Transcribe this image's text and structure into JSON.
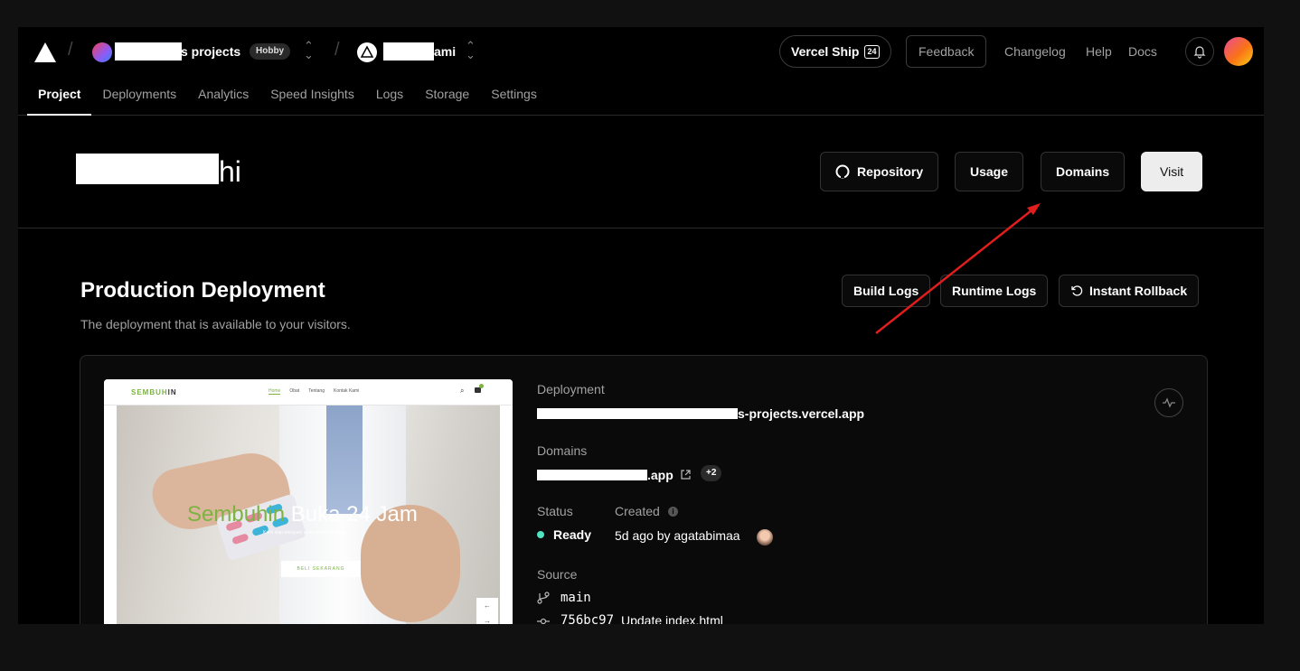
{
  "topbar": {
    "team_name_suffix": "s projects",
    "plan_badge": "Hobby",
    "project_name_suffix": "ami",
    "ship_label": "Vercel Ship",
    "ship_badge": "24",
    "feedback_label": "Feedback",
    "changelog_label": "Changelog",
    "help_label": "Help",
    "docs_label": "Docs"
  },
  "tabs": [
    "Project",
    "Deployments",
    "Analytics",
    "Speed Insights",
    "Logs",
    "Storage",
    "Settings"
  ],
  "header": {
    "project_title_suffix": "hi",
    "repository_label": "Repository",
    "usage_label": "Usage",
    "domains_label": "Domains",
    "visit_label": "Visit"
  },
  "production": {
    "title": "Production Deployment",
    "subtitle": "The deployment that is available to your visitors.",
    "build_logs_label": "Build Logs",
    "runtime_logs_label": "Runtime Logs",
    "rollback_label": "Instant Rollback"
  },
  "preview": {
    "brand_green": "SEMBUH",
    "brand_dark": "IN",
    "menu": [
      "Home",
      "Obat",
      "Tentang",
      "Kontak Kami"
    ],
    "headline_green": "Sembuhin",
    "headline_white": "Buka 24 Jam",
    "tagline": "Kami siap melayani anda selama 24 Jam",
    "cta": "BELI SEKARANG"
  },
  "deployment": {
    "deployment_label": "Deployment",
    "deployment_url_suffix": "s-projects.vercel.app",
    "domains_label": "Domains",
    "domain_suffix": ".app",
    "domains_more": "+2",
    "status_label": "Status",
    "created_label": "Created",
    "status_value": "Ready",
    "created_value": "5d ago by agatabimaa",
    "source_label": "Source",
    "branch": "main",
    "commit_hash": "756bc97",
    "commit_message": "Update index.html"
  },
  "colors": {
    "background": "#000000",
    "status_ready": "#50e3c2",
    "annotation_arrow": "#e11d1d",
    "preview_brand": "#7cb342"
  }
}
